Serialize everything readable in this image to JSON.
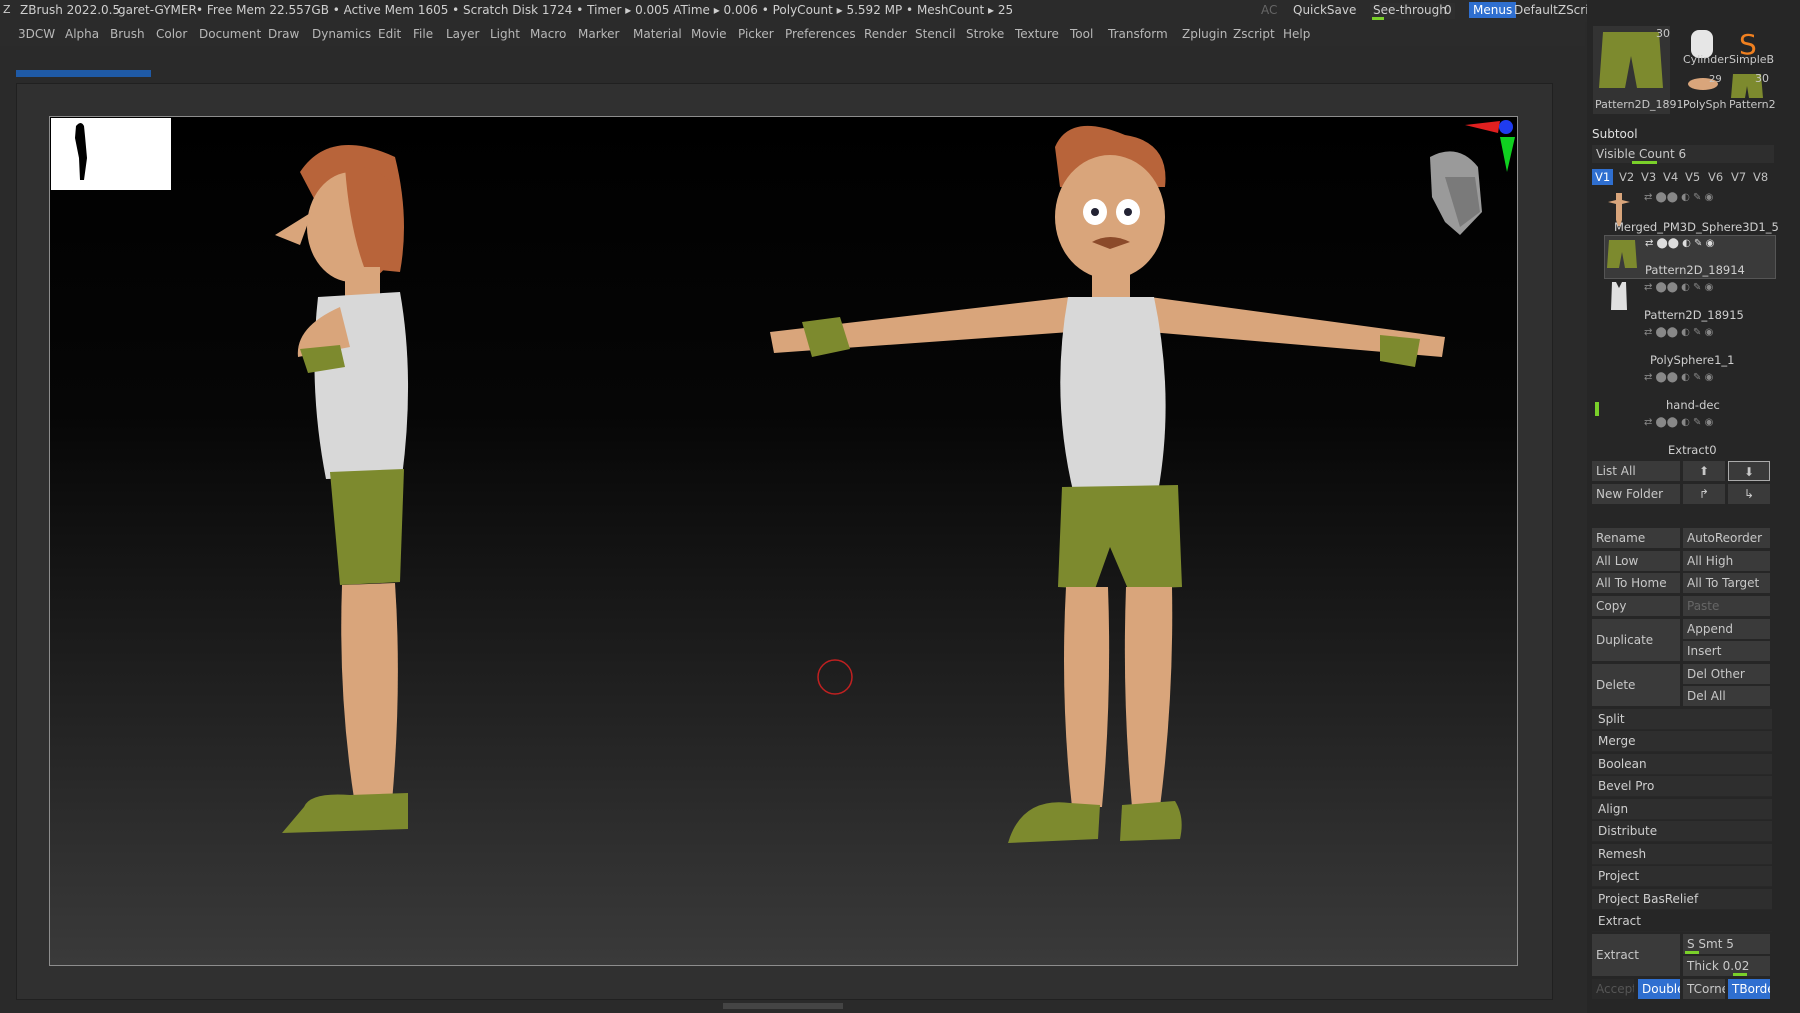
{
  "titlebar": {
    "app": "ZBrush 2022.0.5",
    "project": "garet-GYMER",
    "stats": "• Free Mem 22.557GB • Active Mem 1605 • Scratch Disk 1724 • Timer ▸ 0.005 ATime ▸ 0.006 • PolyCount ▸ 5.592 MP • MeshCount ▸ 25",
    "ac": "AC",
    "quicksave": "QuickSave",
    "seethrough": "See-through",
    "seethrough_value": "0",
    "menus": "Menus",
    "script": "DefaultZScript"
  },
  "menubar": {
    "items": [
      "3DCW",
      "Alpha",
      "Brush",
      "Color",
      "Document",
      "Draw",
      "Dynamics",
      "Edit",
      "File",
      "Layer",
      "Light",
      "Macro",
      "Marker",
      "Material",
      "Movie",
      "Picker",
      "Preferences",
      "Render",
      "Stencil",
      "Stroke",
      "Texture",
      "Tool",
      "Transform",
      "Zplugin",
      "Zscript",
      "Help"
    ]
  },
  "progress": {
    "value": 0.08
  },
  "tool_palette": {
    "thumbs": [
      {
        "label": "Pattern2D_1891-",
        "count": "30"
      },
      {
        "label": "Cylinder"
      },
      {
        "label": "SimpleB"
      },
      {
        "label": "PolySph",
        "count": "29"
      },
      {
        "label": "Pattern2",
        "count": "30"
      }
    ]
  },
  "subtool": {
    "title": "Subtool",
    "visible_count": "Visible Count 6",
    "version_tabs": [
      "V1",
      "V2",
      "V3",
      "V4",
      "V5",
      "V6",
      "V7",
      "V8"
    ],
    "items": [
      {
        "name": "Merged_PM3D_Sphere3D1_5"
      },
      {
        "name": "Pattern2D_18914"
      },
      {
        "name": "Pattern2D_18915"
      },
      {
        "name": "PolySphere1_1"
      },
      {
        "name": "hand-dec"
      },
      {
        "name": "Extract0"
      }
    ],
    "list_all": "List All",
    "new_folder": "New Folder",
    "rename": "Rename",
    "auto_reorder": "AutoReorder",
    "all_low": "All Low",
    "all_high": "All High",
    "all_to_home": "All To Home",
    "all_to_target": "All To Target",
    "copy": "Copy",
    "paste": "Paste",
    "duplicate": "Duplicate",
    "append": "Append",
    "insert": "Insert",
    "delete": "Delete",
    "del_other": "Del Other",
    "del_all": "Del All",
    "sections": [
      "Split",
      "Merge",
      "Boolean",
      "Bevel Pro",
      "Align",
      "Distribute",
      "Remesh",
      "Project",
      "Project BasRelief",
      "Extract"
    ],
    "extract_btn": "Extract",
    "s_smt": "S Smt 5",
    "thick": "Thick 0.02",
    "accept": "Accept",
    "double": "Double",
    "tcorne": "TCorne",
    "tborde": "TBorde"
  },
  "colors": {
    "accent": "#2f6fd0",
    "skin": "#d9a57b",
    "hair": "#b8643a",
    "shorts": "#7d8a2e",
    "shirt": "#d8d8d8"
  }
}
